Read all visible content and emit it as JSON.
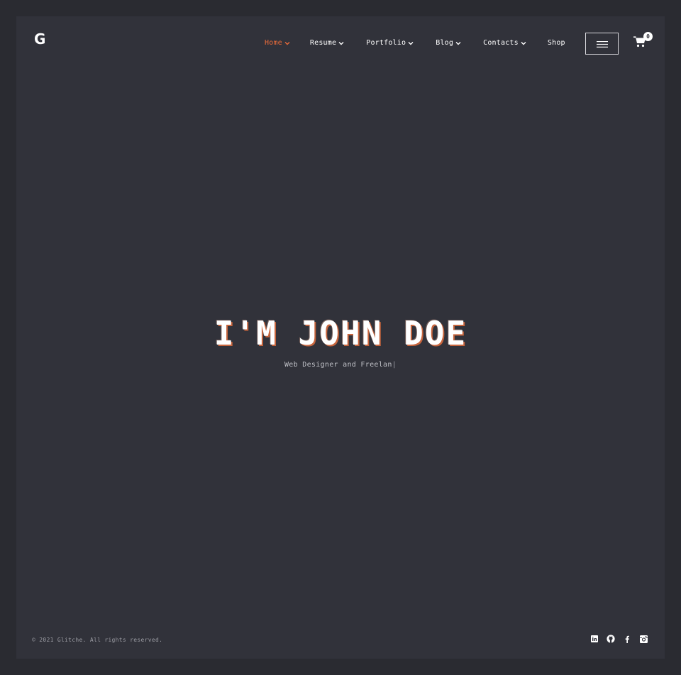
{
  "brand": {
    "logo": "G"
  },
  "nav": {
    "items": [
      {
        "label": "Home",
        "active": true,
        "dropdown": true
      },
      {
        "label": "Resume",
        "active": false,
        "dropdown": true
      },
      {
        "label": "Portfolio",
        "active": false,
        "dropdown": true
      },
      {
        "label": "Blog",
        "active": false,
        "dropdown": true
      },
      {
        "label": "Contacts",
        "active": false,
        "dropdown": true
      },
      {
        "label": "Shop",
        "active": false,
        "dropdown": false
      }
    ],
    "menu_icon": "hamburger-icon",
    "cart_icon": "cart-icon",
    "cart_count": "0"
  },
  "hero": {
    "title": "I'M JOHN DOE",
    "subtitle": "Web Designer and Freelan",
    "cursor": "|"
  },
  "footer": {
    "copyright": "© 2021 Glitche. All rights reserved.",
    "social": [
      "linkedin-icon",
      "github-icon",
      "facebook-icon",
      "instagram-icon"
    ]
  },
  "colors": {
    "accent": "#e86b3a",
    "background": "#31323a",
    "outer": "#2a2b31",
    "text": "#ffffff"
  }
}
